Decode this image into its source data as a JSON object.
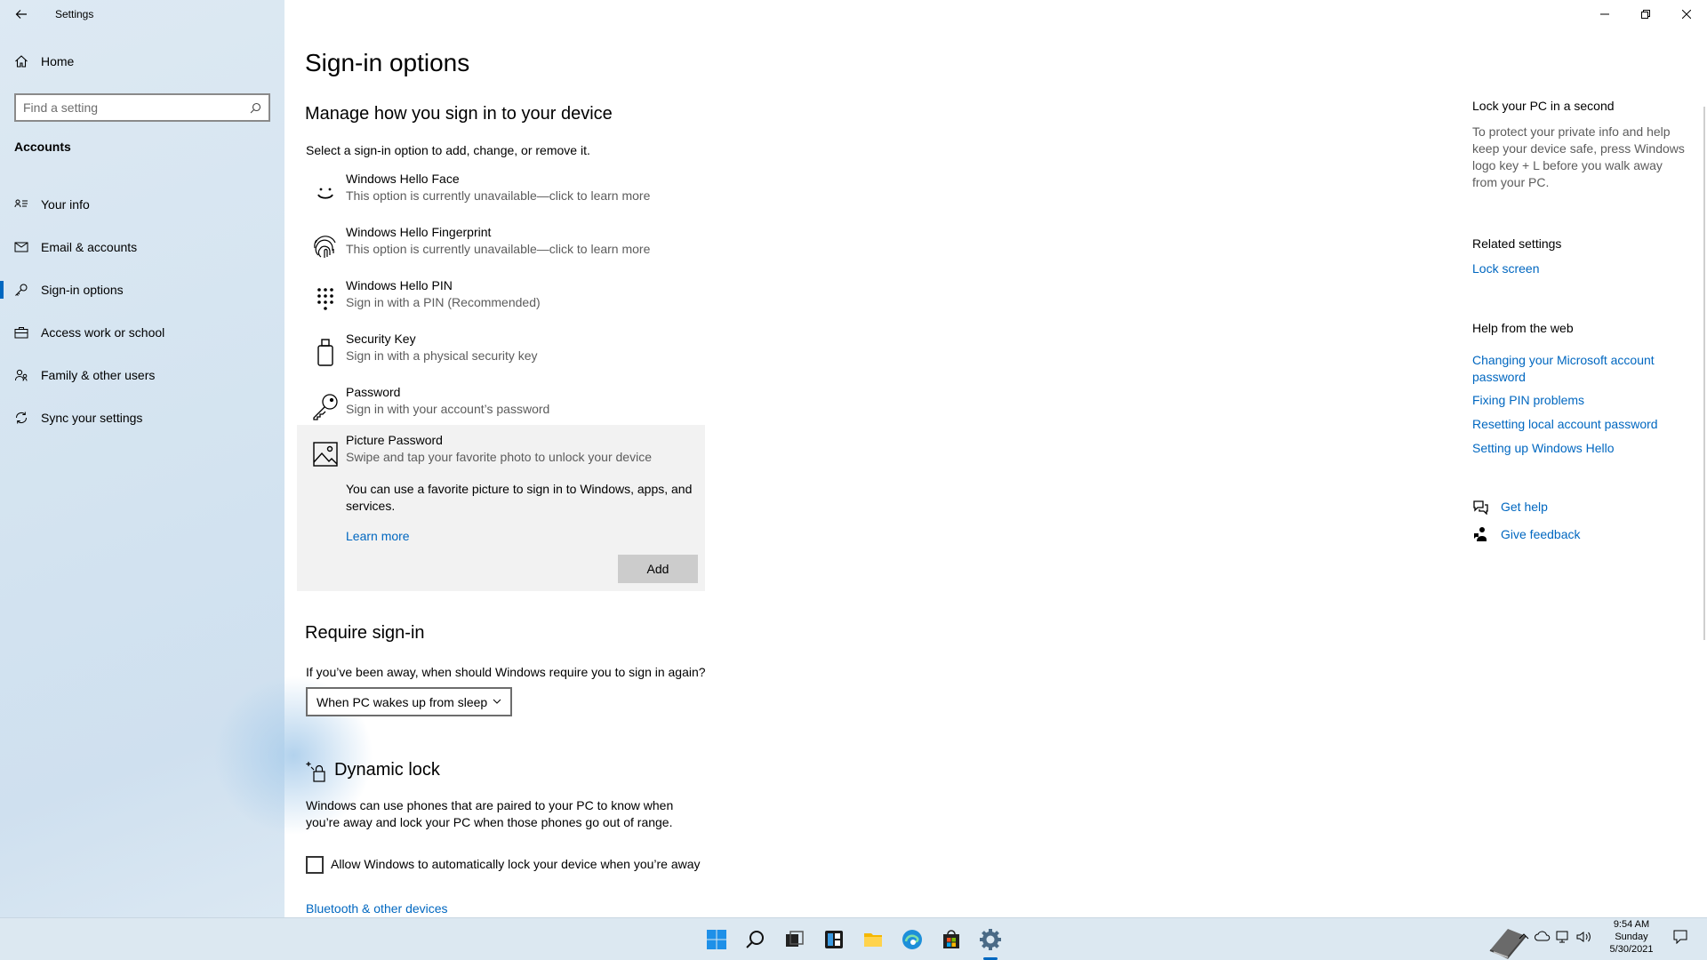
{
  "app": {
    "title": "Settings"
  },
  "sidebar": {
    "home_label": "Home",
    "search_placeholder": "Find a setting",
    "section_label": "Accounts",
    "items": [
      {
        "label": "Your info",
        "icon": "person-card-icon"
      },
      {
        "label": "Email & accounts",
        "icon": "mail-icon"
      },
      {
        "label": "Sign-in options",
        "icon": "key-icon",
        "active": true
      },
      {
        "label": "Access work or school",
        "icon": "briefcase-icon"
      },
      {
        "label": "Family & other users",
        "icon": "people-icon"
      },
      {
        "label": "Sync your settings",
        "icon": "sync-icon"
      }
    ]
  },
  "main": {
    "title": "Sign-in options",
    "manage_heading": "Manage how you sign in to your device",
    "manage_desc": "Select a sign-in option to add, change, or remove it.",
    "options": [
      {
        "title": "Windows Hello Face",
        "sub": "This option is currently unavailable—click to learn more",
        "icon": "face-icon"
      },
      {
        "title": "Windows Hello Fingerprint",
        "sub": "This option is currently unavailable—click to learn more",
        "icon": "fingerprint-icon"
      },
      {
        "title": "Windows Hello PIN",
        "sub": "Sign in with a PIN (Recommended)",
        "icon": "pin-keypad-icon"
      },
      {
        "title": "Security Key",
        "sub": "Sign in with a physical security key",
        "icon": "usb-key-icon"
      },
      {
        "title": "Password",
        "sub": "Sign in with your account’s password",
        "icon": "password-key-icon"
      },
      {
        "title": "Picture Password",
        "sub": "Swipe and tap your favorite photo to unlock your device",
        "icon": "picture-icon"
      }
    ],
    "picture_desc": "You can use a favorite picture to sign in to Windows, apps, and services.",
    "learn_more": "Learn more",
    "add_button": "Add",
    "require_heading": "Require sign-in",
    "require_desc": "If you’ve been away, when should Windows require you to sign in again?",
    "require_value": "When PC wakes up from sleep",
    "dynamic_heading": "Dynamic lock",
    "dynamic_desc": "Windows can use phones that are paired to your PC to know when you’re away and lock your PC when those phones go out of range.",
    "dynamic_checkbox": "Allow Windows to automatically lock your device when you’re away",
    "dynamic_checked": false,
    "bluetooth_link": "Bluetooth & other devices"
  },
  "right": {
    "lock_heading": "Lock your PC in a second",
    "lock_desc": "To protect your private info and help keep your device safe, press Windows logo key + L before you walk away from your PC.",
    "related_heading": "Related settings",
    "related_links": [
      "Lock screen"
    ],
    "help_heading": "Help from the web",
    "help_links": [
      "Changing your Microsoft account password",
      "Fixing PIN problems",
      "Resetting local account password",
      "Setting up Windows Hello"
    ],
    "get_help": "Get help",
    "give_feedback": "Give feedback"
  },
  "taskbar": {
    "apps": [
      "windows-start-icon",
      "search-icon",
      "task-view-icon",
      "widgets-icon",
      "file-explorer-icon",
      "edge-icon",
      "store-icon",
      "settings-icon"
    ],
    "time": "9:54 AM",
    "day": "Sunday",
    "date": "5/30/2021"
  },
  "colors": {
    "accent": "#0067c0",
    "sidebar": "#d8e6f2",
    "taskbar": "#dce8f1",
    "expanded": "#f2f2f2"
  }
}
